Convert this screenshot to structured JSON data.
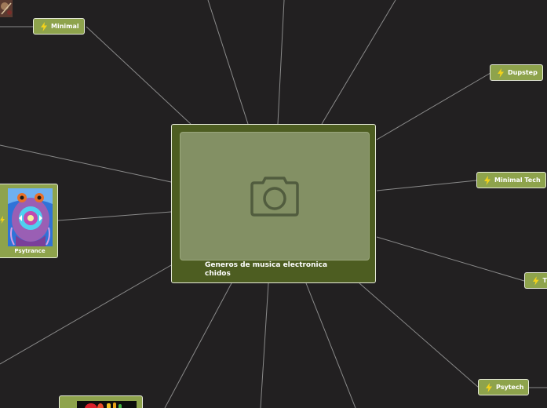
{
  "central": {
    "title": "Generos de musica electronica chidos",
    "image_icon": "camera-icon"
  },
  "nodes": {
    "minimal": "Minimal",
    "dubstep": "Dupstep",
    "minimal_tech": "Minimal Tech",
    "techno_partial": "T",
    "psytech": "Psytech",
    "psytrance": "Psytrance"
  },
  "icons": {
    "node_icon": "lightning-bolt-icon"
  },
  "colors": {
    "background": "#222021",
    "node_fill": "#8ea34c",
    "node_border": "#e6ead9",
    "central_fill": "#4d5d21",
    "placeholder_fill": "#839064",
    "link": "#8a8a8a",
    "bolt": "#f2d21b"
  }
}
